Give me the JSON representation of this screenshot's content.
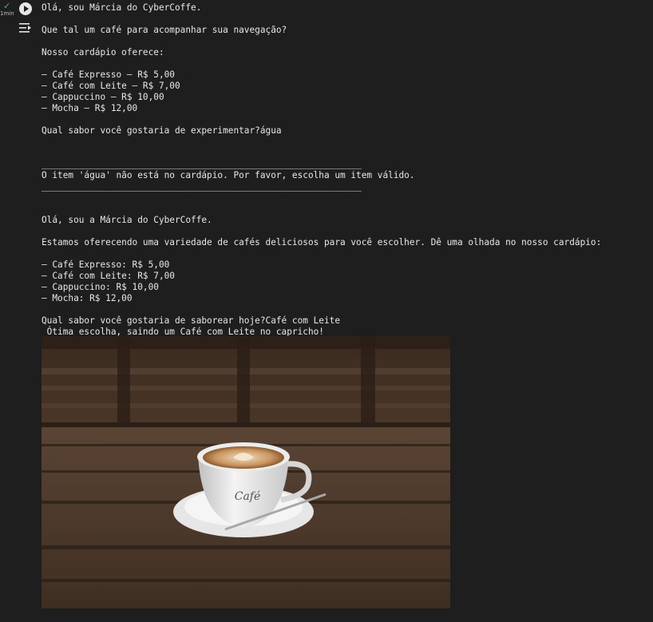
{
  "cell": {
    "status_check": "✓",
    "elapsed": "1min",
    "run_icon": "play-circle-icon",
    "output_icon": "output-toggle-icon"
  },
  "output": {
    "lines": [
      "Olá, sou Márcia do CyberCoffe.",
      "",
      "Que tal um café para acompanhar sua navegação?",
      "",
      "Nosso cardápio oferece:",
      "",
      "– Café Expresso – R$ 5,00",
      "– Café com Leite – R$ 7,00",
      "– Cappuccino – R$ 10,00",
      "– Mocha – R$ 12,00",
      "",
      "Qual sabor você gostaria de experimentar?água",
      "",
      "",
      "____________________________________________________________",
      "O item 'água' não está no cardápio. Por favor, escolha um item válido.",
      "____________________________________________________________",
      "",
      "",
      "Olá, sou a Márcia do CyberCoffe.",
      "",
      "Estamos oferecendo uma variedade de cafés deliciosos para você escolher. Dê uma olhada no nosso cardápio:",
      "",
      "– Café Expresso: R$ 5,00",
      "– Café com Leite: R$ 7,00",
      "– Cappuccino: R$ 10,00",
      "– Mocha: R$ 12,00",
      "",
      "Qual sabor você gostaria de saborear hoje?Café com Leite",
      " Ótima escolha, saindo um Café com Leite no capricho!"
    ],
    "cup_text": "Café"
  }
}
